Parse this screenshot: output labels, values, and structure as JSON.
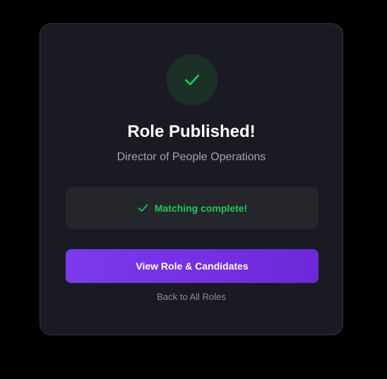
{
  "dialog": {
    "title": "Role Published!",
    "subtitle": "Director of People Operations",
    "status": {
      "icon": "check-icon",
      "text": "Matching complete!"
    },
    "primary_button_label": "View Role & Candidates",
    "back_link_label": "Back to All Roles"
  },
  "colors": {
    "accent": "#7c3aed",
    "success": "#22c55e",
    "card_background": "#1a1b22"
  }
}
